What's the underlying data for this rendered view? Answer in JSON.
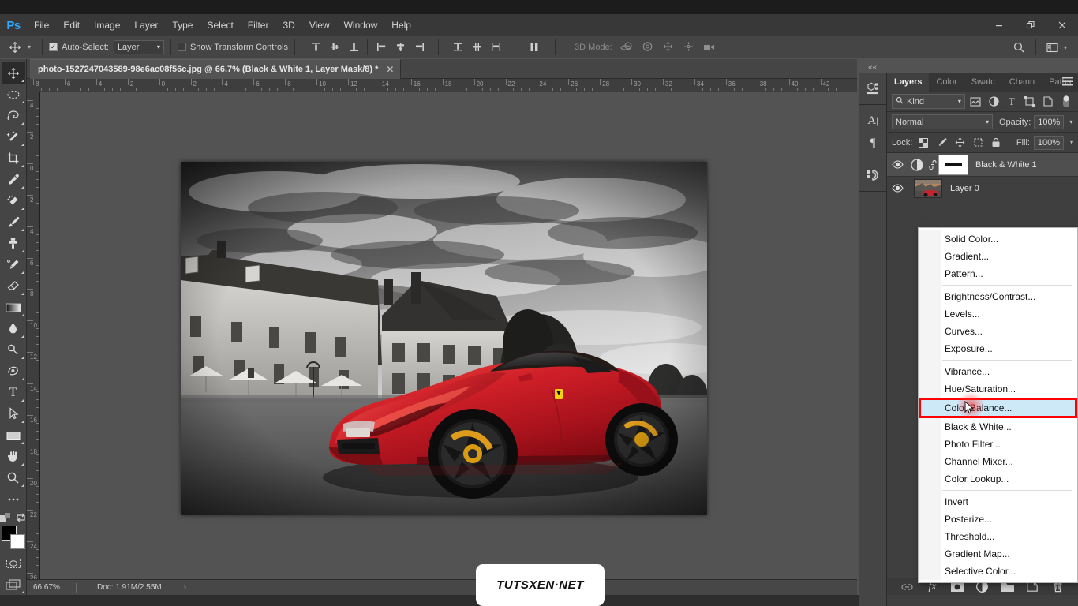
{
  "app": {
    "logo": "Ps",
    "menus": [
      "File",
      "Edit",
      "Image",
      "Layer",
      "Type",
      "Select",
      "Filter",
      "3D",
      "View",
      "Window",
      "Help"
    ],
    "window_controls": {
      "minimize": "minimize-icon",
      "restore": "restore-icon",
      "close": "close-icon"
    }
  },
  "options_bar": {
    "tool_icon": "move-tool-icon",
    "auto_select_label": "Auto-Select:",
    "auto_select_checked": true,
    "auto_select_value": "Layer",
    "show_transform_label": "Show Transform Controls",
    "show_transform_checked": false,
    "align_icons": [
      "align-top-edges-icon",
      "align-vertical-centers-icon",
      "align-bottom-edges-icon",
      "align-left-edges-icon",
      "align-horizontal-centers-icon",
      "align-right-edges-icon",
      "distribute-top-icon",
      "distribute-vertical-center-icon",
      "distribute-bottom-icon",
      "distribute-left-icon",
      "distribute-horizontal-center-icon",
      "distribute-right-icon",
      "distribute-spacing-icon"
    ],
    "mode_3d_label": "3D Mode:",
    "mode_3d_icons": [
      "3d-orbit-icon",
      "3d-roll-icon",
      "3d-pan-icon",
      "3d-slide-icon",
      "3d-camera-icon"
    ],
    "search_icon": "search-icon",
    "workspace_icon": "workspace-switcher-icon"
  },
  "document": {
    "tab_title": "photo-1527247043589-98e6ac08f56c.jpg @ 66.7%  (Black & White 1, Layer Mask/8) *",
    "close_icon": "close-tab-icon",
    "ruler_h_ticks": [
      "8",
      "6",
      "4",
      "2",
      "0",
      "2",
      "4",
      "6",
      "8",
      "10",
      "12",
      "14",
      "16",
      "18",
      "20",
      "22",
      "24",
      "26",
      "28",
      "30",
      "32",
      "34",
      "36",
      "38",
      "40",
      "42"
    ],
    "ruler_v_ticks": [
      "4",
      "2",
      "0",
      "2",
      "4",
      "6",
      "8",
      "10",
      "12",
      "14",
      "16",
      "18",
      "20",
      "22",
      "24",
      "26"
    ]
  },
  "toolbar": {
    "tools": [
      {
        "name": "move-tool-icon",
        "active": true
      },
      {
        "name": "elliptical-marquee-tool-icon",
        "active": false
      },
      {
        "name": "lasso-tool-icon",
        "active": false
      },
      {
        "name": "magic-wand-tool-icon",
        "active": false
      },
      {
        "name": "crop-tool-icon",
        "active": false
      },
      {
        "name": "eyedropper-tool-icon",
        "active": false
      },
      {
        "name": "spot-healing-brush-tool-icon",
        "active": false
      },
      {
        "name": "brush-tool-icon",
        "active": false
      },
      {
        "name": "clone-stamp-tool-icon",
        "active": false
      },
      {
        "name": "history-brush-tool-icon",
        "active": false
      },
      {
        "name": "eraser-tool-icon",
        "active": false
      },
      {
        "name": "gradient-tool-icon",
        "active": false
      },
      {
        "name": "blur-tool-icon",
        "active": false
      },
      {
        "name": "dodge-tool-icon",
        "active": false
      },
      {
        "name": "pen-tool-icon",
        "active": false
      },
      {
        "name": "type-tool-icon",
        "active": false
      },
      {
        "name": "path-selection-tool-icon",
        "active": false
      },
      {
        "name": "rectangle-tool-icon",
        "active": false
      },
      {
        "name": "hand-tool-icon",
        "active": false
      },
      {
        "name": "zoom-tool-icon",
        "active": false
      },
      {
        "name": "edit-toolbar-icon",
        "active": false
      }
    ],
    "foreground_color": "#000000",
    "background_color": "#ffffff",
    "quick_mask_icon": "quick-mask-icon",
    "screen_mode_icon": "screen-mode-icon"
  },
  "status_bar": {
    "zoom": "66.67%",
    "doc_info": "Doc: 1.91M/2.55M",
    "expand_arrow": "›"
  },
  "watermark": {
    "text": "TUTSXEN·NET"
  },
  "dock": {
    "collapse_arrows": "««",
    "icons": [
      "properties-3d-icon",
      "character-icon",
      "paragraph-icon",
      "libraries-icon"
    ]
  },
  "layers_panel": {
    "tabs": [
      {
        "label": "Layers",
        "active": true
      },
      {
        "label": "Color",
        "active": false
      },
      {
        "label": "Swatc",
        "active": false
      },
      {
        "label": "Chann",
        "active": false
      },
      {
        "label": "Paths",
        "active": false
      }
    ],
    "panel_menu_icon": "hamburger-menu-icon",
    "filter": {
      "search_icon": "search-icon",
      "kind_label": "Kind",
      "caret": "⌄",
      "type_icons": [
        "filter-pixel-icon",
        "filter-adjustment-icon",
        "filter-type-icon",
        "filter-shape-icon",
        "filter-smart-object-icon"
      ],
      "toggle_icon": "filter-toggle-icon"
    },
    "blend": {
      "mode": "Normal",
      "caret": "⌄",
      "opacity_label": "Opacity:",
      "opacity_value": "100%"
    },
    "lock": {
      "label": "Lock:",
      "icons": [
        "lock-transparent-pixels-icon",
        "lock-image-pixels-icon",
        "lock-position-icon",
        "lock-artboard-icon",
        "lock-all-icon"
      ],
      "fill_label": "Fill:",
      "fill_value": "100%"
    },
    "layers": [
      {
        "name": "Black & White 1",
        "visible": true,
        "selected": true,
        "kind": "adjustment",
        "has_mask": true,
        "link_icon": "link-layers-icon",
        "eye_icon": "eye-icon",
        "adjustment_icon": "black-and-white-adjustment-icon"
      },
      {
        "name": "Layer 0",
        "visible": true,
        "selected": false,
        "kind": "image",
        "has_mask": false,
        "eye_icon": "eye-icon"
      }
    ],
    "bottom_icons": [
      "link-layers-icon",
      "layer-style-fx-icon",
      "add-layer-mask-icon",
      "new-adjustment-layer-icon",
      "new-group-icon",
      "new-layer-icon",
      "delete-layer-icon"
    ]
  },
  "adjustment_menu": {
    "groups": [
      [
        "Solid Color...",
        "Gradient...",
        "Pattern..."
      ],
      [
        "Brightness/Contrast...",
        "Levels...",
        "Curves...",
        "Exposure..."
      ],
      [
        "Vibrance...",
        "Hue/Saturation...",
        "Color Balance...",
        "Black & White...",
        "Photo Filter...",
        "Channel Mixer...",
        "Color Lookup..."
      ],
      [
        "Invert",
        "Posterize...",
        "Threshold...",
        "Gradient Map...",
        "Selective Color..."
      ]
    ],
    "highlighted_item": "Color Balance...",
    "highlight_border_color": "#ff0000",
    "highlight_bg_color": "#cde8f7",
    "cursor_icon": "mouse-pointer-icon"
  },
  "canvas_image": {
    "description": "Red Ferrari 458 sports car in front of a black-and-white chateau under dramatic clouds",
    "car_color": "#c9192b",
    "zoom_percent": "66.7%"
  }
}
